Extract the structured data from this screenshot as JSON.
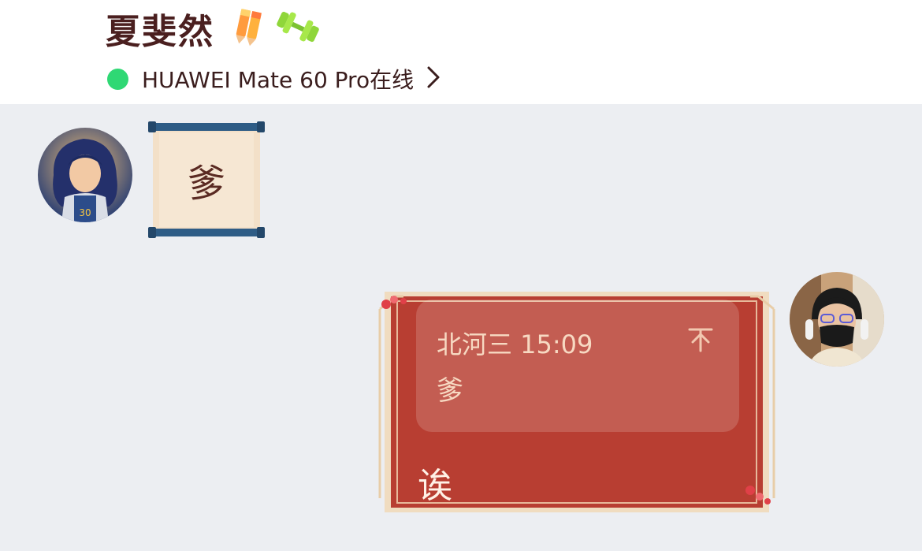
{
  "header": {
    "contact_name": "夏斐然",
    "badges": [
      "pencil-badge-icon",
      "dumbbell-badge-icon"
    ],
    "status": {
      "dot_color": "#2fd874",
      "text": "HUAWEI Mate 60 Pro在线"
    }
  },
  "messages": [
    {
      "side": "left",
      "type": "sticker",
      "sticker_char": "爹"
    },
    {
      "side": "right",
      "type": "text_with_quote",
      "quote": {
        "meta": "北河三 15:09",
        "text": "爹"
      },
      "text": "诶"
    }
  ],
  "colors": {
    "background": "#eceef2",
    "header_bg": "#ffffff",
    "bubble_red": "#b83e32",
    "online": "#2fd874"
  }
}
